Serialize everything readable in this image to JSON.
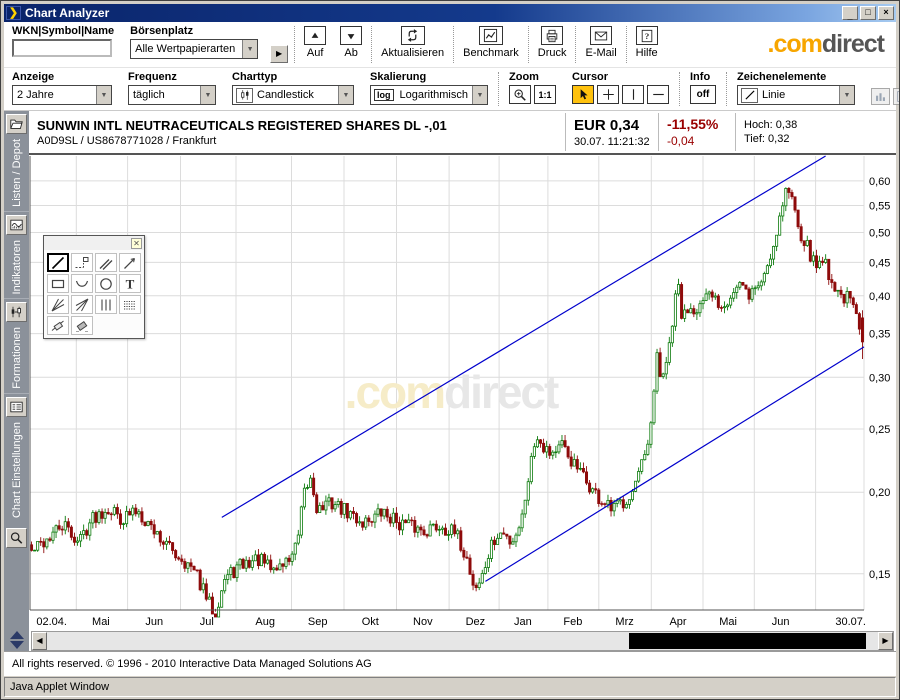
{
  "window": {
    "title": "Chart Analyzer"
  },
  "brand": {
    "com": ".com",
    "direct": "direct"
  },
  "toolbar1": {
    "wkn_label": "WKN|Symbol|Name",
    "wkn_value": "",
    "boersenplatz_label": "Börsenplatz",
    "boersenplatz_value": "Alle Wertpapierarten",
    "auf": "Auf",
    "ab": "Ab",
    "aktualisieren": "Aktualisieren",
    "benchmark": "Benchmark",
    "druck": "Druck",
    "email": "E-Mail",
    "hilfe": "Hilfe"
  },
  "toolbar2": {
    "anzeige_label": "Anzeige",
    "anzeige_value": "2 Jahre",
    "frequenz_label": "Frequenz",
    "frequenz_value": "täglich",
    "charttyp_label": "Charttyp",
    "charttyp_value": "Candlestick",
    "skalierung_label": "Skalierung",
    "skalierung_icon_text": "log",
    "skalierung_value": "Logarithmisch",
    "zoom_label": "Zoom",
    "one_to_one": "1:1",
    "cursor_label": "Cursor",
    "info_label": "Info",
    "info_value": "off",
    "zeichen_label": "Zeichenelemente",
    "zeichen_value": "Linie"
  },
  "instrument": {
    "name": "SUNWIN INTL NEUTRACEUTICALS REGISTERED SHARES DL -,01",
    "details": "A0D9SL / US8678771028 / Frankfurt",
    "price": "EUR 0,34",
    "timestamp": "30.07. 11:21:32",
    "change_pct": "-11,55%",
    "change_abs": "-0,04",
    "high_label": "Hoch: 0,38",
    "low_label": "Tief: 0,32"
  },
  "sidebar": {
    "tabs": [
      {
        "label": "Listen / Depot",
        "icon": "folder"
      },
      {
        "label": "Indikatoren",
        "icon": "indicator"
      },
      {
        "label": "Formationen",
        "icon": "formation"
      },
      {
        "label": "Chart Einstellungen",
        "icon": "settingslist"
      }
    ]
  },
  "palette": {
    "tools": [
      {
        "name": "line-tool",
        "icon": "line",
        "selected": true
      },
      {
        "name": "segment-label-tool",
        "icon": "segmentlabel",
        "selected": false
      },
      {
        "name": "parallel-lines-tool",
        "icon": "parallel",
        "selected": false
      },
      {
        "name": "trend-arrow-tool",
        "icon": "trendarrow",
        "selected": false
      },
      {
        "name": "rectangle-tool",
        "icon": "rectangle",
        "selected": false
      },
      {
        "name": "arc-tool",
        "icon": "arc",
        "selected": false
      },
      {
        "name": "ellipse-tool",
        "icon": "ellipse",
        "selected": false
      },
      {
        "name": "text-tool",
        "icon": "texttool",
        "selected": false
      },
      {
        "name": "fan-lines-tool",
        "icon": "fanbl",
        "selected": false
      },
      {
        "name": "retracement-fan-tool",
        "icon": "fantr",
        "selected": false
      },
      {
        "name": "vertical-lines-tool",
        "icon": "vlines",
        "selected": false
      },
      {
        "name": "grid-tool",
        "icon": "gridtool",
        "selected": false
      },
      {
        "name": "erase-element-tool",
        "icon": "eraseline",
        "selected": false
      },
      {
        "name": "erase-all-tool",
        "icon": "eraseall",
        "selected": false
      }
    ]
  },
  "chart_data": {
    "type": "candlestick",
    "scale": "log",
    "ylim": [
      0.132,
      0.655
    ],
    "yticks": [
      {
        "label": "0,60",
        "value": 0.6
      },
      {
        "label": "0,55",
        "value": 0.55
      },
      {
        "label": "0,50",
        "value": 0.5
      },
      {
        "label": "0,45",
        "value": 0.45
      },
      {
        "label": "0,40",
        "value": 0.4
      },
      {
        "label": "0,35",
        "value": 0.35
      },
      {
        "label": "0,30",
        "value": 0.3
      },
      {
        "label": "0,25",
        "value": 0.25
      },
      {
        "label": "0,20",
        "value": 0.2
      },
      {
        "label": "0,15",
        "value": 0.15
      }
    ],
    "xlabels": [
      {
        "label": "02.04.",
        "t": 0.026
      },
      {
        "label": "Mai",
        "t": 0.085
      },
      {
        "label": "Jun",
        "t": 0.149
      },
      {
        "label": "Jul",
        "t": 0.212
      },
      {
        "label": "Aug",
        "t": 0.282
      },
      {
        "label": "Sep",
        "t": 0.345
      },
      {
        "label": "Okt",
        "t": 0.408
      },
      {
        "label": "Nov",
        "t": 0.471
      },
      {
        "label": "Dez",
        "t": 0.534
      },
      {
        "label": "Jan",
        "t": 0.591
      },
      {
        "label": "Feb",
        "t": 0.651
      },
      {
        "label": "Mrz",
        "t": 0.713
      },
      {
        "label": "Apr",
        "t": 0.777
      },
      {
        "label": "Mai",
        "t": 0.837
      },
      {
        "label": "Jun",
        "t": 0.9
      },
      {
        "label": "30.07.",
        "t": 0.984
      }
    ],
    "price_path": [
      [
        0.0,
        0.162
      ],
      [
        0.02,
        0.17
      ],
      [
        0.038,
        0.178
      ],
      [
        0.056,
        0.168
      ],
      [
        0.074,
        0.183
      ],
      [
        0.092,
        0.19
      ],
      [
        0.11,
        0.182
      ],
      [
        0.128,
        0.188
      ],
      [
        0.146,
        0.176
      ],
      [
        0.164,
        0.165
      ],
      [
        0.182,
        0.158
      ],
      [
        0.2,
        0.148
      ],
      [
        0.212,
        0.136
      ],
      [
        0.221,
        0.131
      ],
      [
        0.232,
        0.147
      ],
      [
        0.25,
        0.154
      ],
      [
        0.272,
        0.158
      ],
      [
        0.29,
        0.152
      ],
      [
        0.308,
        0.157
      ],
      [
        0.32,
        0.166
      ],
      [
        0.328,
        0.198
      ],
      [
        0.336,
        0.21
      ],
      [
        0.344,
        0.188
      ],
      [
        0.362,
        0.193
      ],
      [
        0.38,
        0.186
      ],
      [
        0.398,
        0.18
      ],
      [
        0.422,
        0.186
      ],
      [
        0.446,
        0.179
      ],
      [
        0.47,
        0.175
      ],
      [
        0.494,
        0.178
      ],
      [
        0.512,
        0.171
      ],
      [
        0.524,
        0.158
      ],
      [
        0.533,
        0.142
      ],
      [
        0.542,
        0.148
      ],
      [
        0.554,
        0.166
      ],
      [
        0.566,
        0.173
      ],
      [
        0.578,
        0.168
      ],
      [
        0.59,
        0.182
      ],
      [
        0.599,
        0.216
      ],
      [
        0.608,
        0.247
      ],
      [
        0.614,
        0.238
      ],
      [
        0.626,
        0.23
      ],
      [
        0.638,
        0.235
      ],
      [
        0.652,
        0.221
      ],
      [
        0.668,
        0.207
      ],
      [
        0.683,
        0.195
      ],
      [
        0.698,
        0.187
      ],
      [
        0.712,
        0.194
      ],
      [
        0.724,
        0.201
      ],
      [
        0.74,
        0.228
      ],
      [
        0.748,
        0.262
      ],
      [
        0.752,
        0.33
      ],
      [
        0.757,
        0.3
      ],
      [
        0.764,
        0.31
      ],
      [
        0.772,
        0.368
      ],
      [
        0.778,
        0.42
      ],
      [
        0.783,
        0.365
      ],
      [
        0.79,
        0.385
      ],
      [
        0.806,
        0.386
      ],
      [
        0.818,
        0.4
      ],
      [
        0.83,
        0.388
      ],
      [
        0.842,
        0.402
      ],
      [
        0.852,
        0.415
      ],
      [
        0.862,
        0.4
      ],
      [
        0.878,
        0.42
      ],
      [
        0.89,
        0.462
      ],
      [
        0.899,
        0.52
      ],
      [
        0.908,
        0.585
      ],
      [
        0.916,
        0.56
      ],
      [
        0.926,
        0.5
      ],
      [
        0.935,
        0.47
      ],
      [
        0.944,
        0.442
      ],
      [
        0.952,
        0.46
      ],
      [
        0.962,
        0.425
      ],
      [
        0.971,
        0.402
      ],
      [
        0.98,
        0.398
      ],
      [
        0.988,
        0.388
      ],
      [
        1.0,
        0.34
      ]
    ],
    "candle_count": 272,
    "last_candle": {
      "open": 0.37,
      "high": 0.38,
      "low": 0.32,
      "close": 0.34
    },
    "trendlines": [
      {
        "t1": 0.23,
        "p1": 0.183,
        "t2": 0.954,
        "p2": 0.655
      },
      {
        "t1": 0.546,
        "p1": 0.146,
        "t2": 1.0,
        "p2": 0.334
      }
    ],
    "watermark": {
      "com": ".com",
      "direct": "direct"
    }
  },
  "scrollbar": {
    "thumb_start": 0.7,
    "thumb_width": 0.285
  },
  "footer": {
    "copyright": "All rights reserved. © 1996 - 2010 Interactive Data Managed Solutions AG",
    "java_bar": "Java Applet Window"
  },
  "colors": {
    "up": "#0B7A0B",
    "down": "#8E0B0B",
    "trendline": "#0000CC",
    "grid": "#DCDCDC",
    "axis": "#555555",
    "accent_yellow": "#FFC20E",
    "negative": "#990000",
    "watermark_com": "#F6ECC8",
    "watermark_direct": "#E7E7E7"
  }
}
